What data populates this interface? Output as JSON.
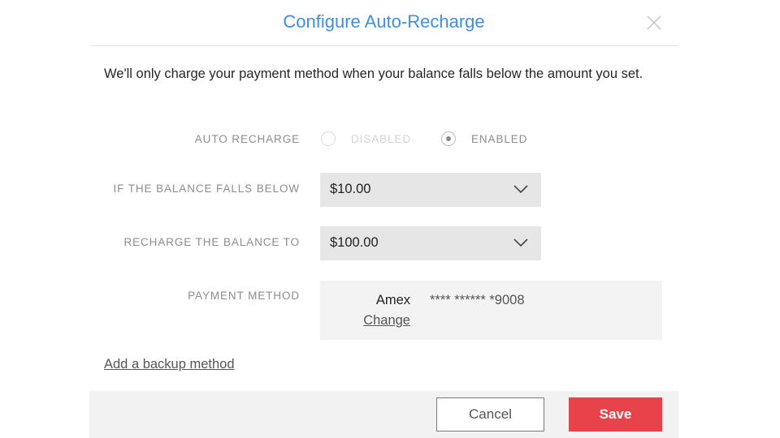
{
  "dialog": {
    "title": "Configure Auto-Recharge",
    "close_icon": "close-icon",
    "description": "We'll only charge your payment method when your balance falls below the amount you set."
  },
  "form": {
    "auto_recharge": {
      "label": "AUTO RECHARGE",
      "options": [
        {
          "label": "DISABLED",
          "selected": false
        },
        {
          "label": "ENABLED",
          "selected": true
        }
      ]
    },
    "threshold": {
      "label": "IF THE BALANCE FALLS BELOW",
      "value": "$10.00",
      "icon": "chevron-down-icon"
    },
    "recharge_to": {
      "label": "RECHARGE THE BALANCE TO",
      "value": "$100.00",
      "icon": "chevron-down-icon"
    },
    "payment_method": {
      "label": "PAYMENT METHOD",
      "brand": "Amex",
      "masked_number": "**** ****** *9008",
      "change_label": "Change"
    },
    "backup_link": "Add a backup method"
  },
  "footer": {
    "cancel_label": "Cancel",
    "save_label": "Save"
  },
  "colors": {
    "title": "#3d8fe3",
    "save_button": "#e8434a",
    "select_bg": "#e6e6e6",
    "payment_bg": "#f3f3f3",
    "footer_bg": "#f2f2f2"
  }
}
